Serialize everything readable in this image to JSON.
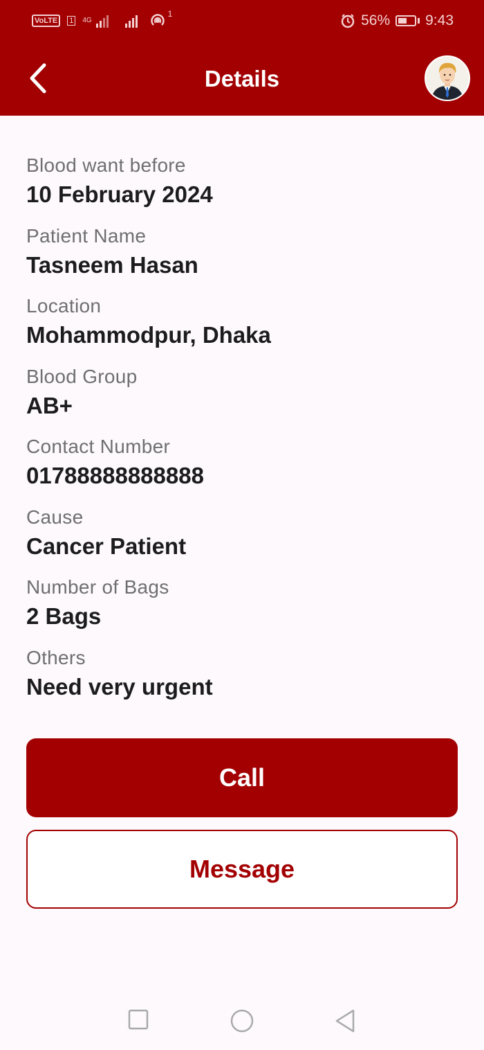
{
  "status_bar": {
    "volte": "VoLTE",
    "sim": "1",
    "network": "4G",
    "hotspot_count": "1",
    "battery_percent": "56%",
    "battery_level": 0.56,
    "time": "9:43"
  },
  "header": {
    "title": "Details",
    "back_icon": "chevron-left-icon",
    "avatar_icon": "user-avatar-icon"
  },
  "details": [
    {
      "label": "Blood want before",
      "value": "10 February 2024"
    },
    {
      "label": "Patient Name",
      "value": "Tasneem Hasan"
    },
    {
      "label": "Location",
      "value": "Mohammodpur, Dhaka"
    },
    {
      "label": "Blood Group",
      "value": "AB+"
    },
    {
      "label": "Contact Number",
      "value": "01788888888888"
    },
    {
      "label": "Cause",
      "value": "Cancer Patient"
    },
    {
      "label": "Number of Bags",
      "value": "2 Bags"
    },
    {
      "label": "Others",
      "value": "Need very urgent"
    }
  ],
  "actions": {
    "call_label": "Call",
    "message_label": "Message"
  },
  "colors": {
    "primary": "#a30002",
    "background": "#fdf9fc",
    "label": "#6f6f72",
    "value": "#1c1c1e"
  },
  "nav_bar": {
    "recents_icon": "square-icon",
    "home_icon": "circle-icon",
    "back_icon": "triangle-back-icon"
  }
}
